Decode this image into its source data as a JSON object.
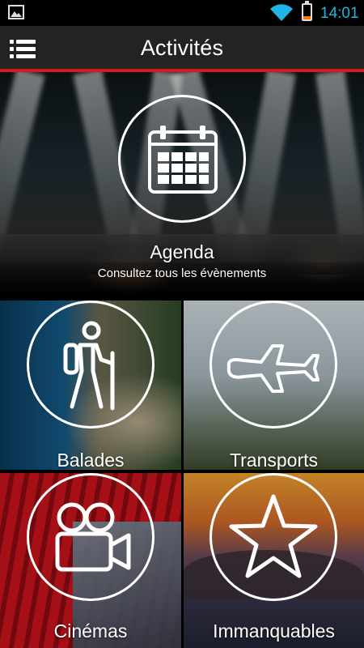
{
  "status_bar": {
    "clock": "14:01",
    "image_icon": "image-notification-icon",
    "wifi_icon": "wifi-icon",
    "battery_icon": "battery-low-icon",
    "battery_level": 0.25,
    "clock_color": "#1fb6e4"
  },
  "header": {
    "title": "Activités",
    "menu_icon": "menu-list-icon",
    "accent_color": "#d71920"
  },
  "tiles": {
    "agenda": {
      "label": "Agenda",
      "subtitle": "Consultez tous les évènements",
      "icon": "calendar-icon"
    },
    "balades": {
      "label": "Balades",
      "icon": "hiker-icon"
    },
    "transports": {
      "label": "Transports",
      "icon": "airplane-icon"
    },
    "cinemas": {
      "label": "Cinémas",
      "icon": "movie-camera-icon"
    },
    "immanquables": {
      "label": "Immanquables",
      "icon": "star-icon"
    }
  }
}
